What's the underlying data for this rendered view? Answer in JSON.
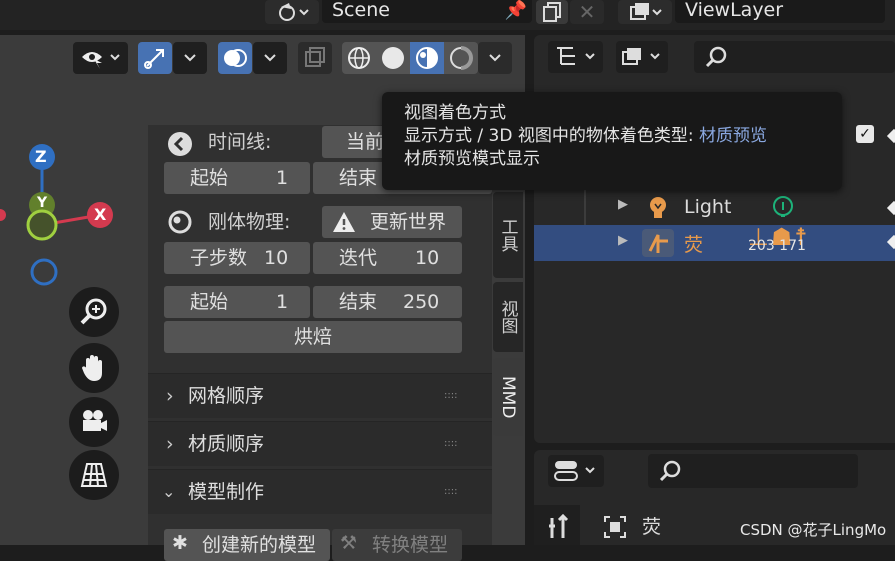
{
  "header": {
    "scene_label": "Scene",
    "view_layer_label": "ViewLayer"
  },
  "tooltip": {
    "title": "视图着色方式",
    "desc_prefix": "显示方式 / 3D 视图中的物体着色类型:",
    "desc_value": "材质预览",
    "desc_line3": "材质预览模式显示"
  },
  "panel": {
    "timeline_label": "时间线:",
    "timeline_value": "当前",
    "start_label": "起始",
    "start_value": "1",
    "end_label": "结束",
    "rigid_label": "刚体物理:",
    "update_world_label": "更新世界",
    "substeps_label": "子步数",
    "substeps_value": "10",
    "iterations_label": "迭代",
    "iterations_value": "10",
    "start2_label": "起始",
    "start2_value": "1",
    "end2_label": "结束",
    "end2_value": "250",
    "bake_label": "烘焙",
    "sections": [
      "网格顺序",
      "材质顺序",
      "模型制作"
    ],
    "create_model_label": "创建新的模型",
    "convert_model_label": "转换模型"
  },
  "side_tabs": [
    "工具",
    "视图",
    "MMD"
  ],
  "gizmo": {
    "z": "Z",
    "y": "Y",
    "x": "X"
  },
  "outliner": {
    "rows": [
      {
        "name": "Light",
        "type": "light"
      },
      {
        "name": "荧",
        "type": "armature",
        "extra": "203 171"
      }
    ]
  },
  "properties": {
    "object_name": "荧"
  },
  "watermark": "CSDN @花子LingMo",
  "colors": {
    "accent_blue": "#4772b3",
    "selected_row": "#334d80",
    "object_orange": "#e89a4b",
    "gizmo_x": "#d43a4f",
    "gizmo_y": "#7ea13a",
    "gizmo_z": "#2f6fc2",
    "link_blue": "#8aa8e0"
  }
}
